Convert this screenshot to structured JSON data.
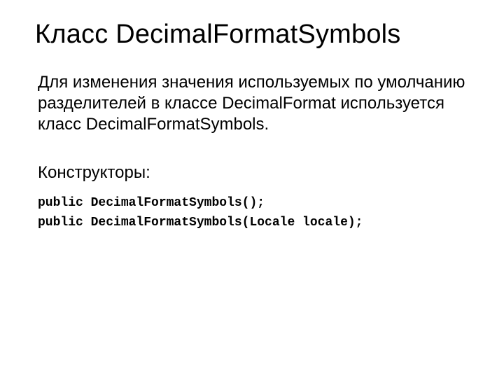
{
  "title": "Класс DecimalFormatSymbols",
  "paragraph": "Для изменения значения используемых по умолчанию разделителей в классе DecimalFormat используется класс DecimalFormatSymbols.",
  "subheading": "Конструкторы:",
  "code": {
    "line1": "public DecimalFormatSymbols();",
    "line2": "public DecimalFormatSymbols(Locale locale);"
  }
}
